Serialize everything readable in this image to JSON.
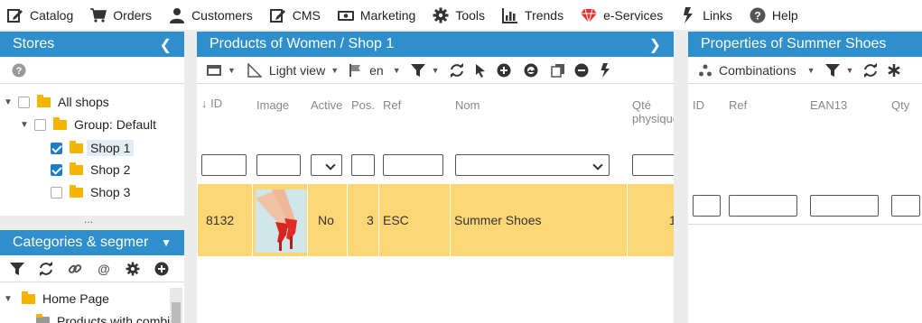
{
  "menu": [
    {
      "label": "Catalog",
      "icon": "edit-icon"
    },
    {
      "label": "Orders",
      "icon": "cart-icon"
    },
    {
      "label": "Customers",
      "icon": "user-icon"
    },
    {
      "label": "CMS",
      "icon": "edit-icon"
    },
    {
      "label": "Marketing",
      "icon": "money-icon"
    },
    {
      "label": "Tools",
      "icon": "gear-icon"
    },
    {
      "label": "Trends",
      "icon": "bar-chart-icon"
    },
    {
      "label": "e-Services",
      "icon": "gem-icon"
    },
    {
      "label": "Links",
      "icon": "bolt-icon"
    },
    {
      "label": "Help",
      "icon": "question-icon"
    }
  ],
  "stores": {
    "title": "Stores",
    "tree": [
      {
        "label": "All shops",
        "checked": false
      },
      {
        "label": "Group: Default",
        "checked": false
      },
      {
        "label": "Shop 1",
        "checked": true,
        "selected": true
      },
      {
        "label": "Shop 2",
        "checked": true
      },
      {
        "label": "Shop 3",
        "checked": false
      }
    ],
    "resize_dots": "..."
  },
  "categories": {
    "title": "Categories & segmer",
    "tree": [
      {
        "label": "Home Page"
      },
      {
        "label": "Products with combi"
      }
    ]
  },
  "products": {
    "title": "Products of Women / Shop 1",
    "toolbar": {
      "view_label": "Light view",
      "lang_label": "en"
    },
    "columns": [
      "ID",
      "Image",
      "Active",
      "Pos.",
      "Ref",
      "Nom",
      "Qté physique"
    ],
    "row": {
      "id": "8132",
      "active": "No",
      "pos": "3",
      "ref": "ESC",
      "nom": "Summer Shoes",
      "qty": "1"
    },
    "highlight_color": "#fdd775"
  },
  "properties": {
    "title": "Properties of Summer Shoes",
    "toolbar": {
      "mode_label": "Combinations"
    },
    "columns": [
      "ID",
      "Ref",
      "EAN13",
      "Qty"
    ]
  },
  "colors": {
    "header_blue": "#2e8fcc",
    "check_blue": "#1f7dc6",
    "folder": "#f5b400"
  }
}
